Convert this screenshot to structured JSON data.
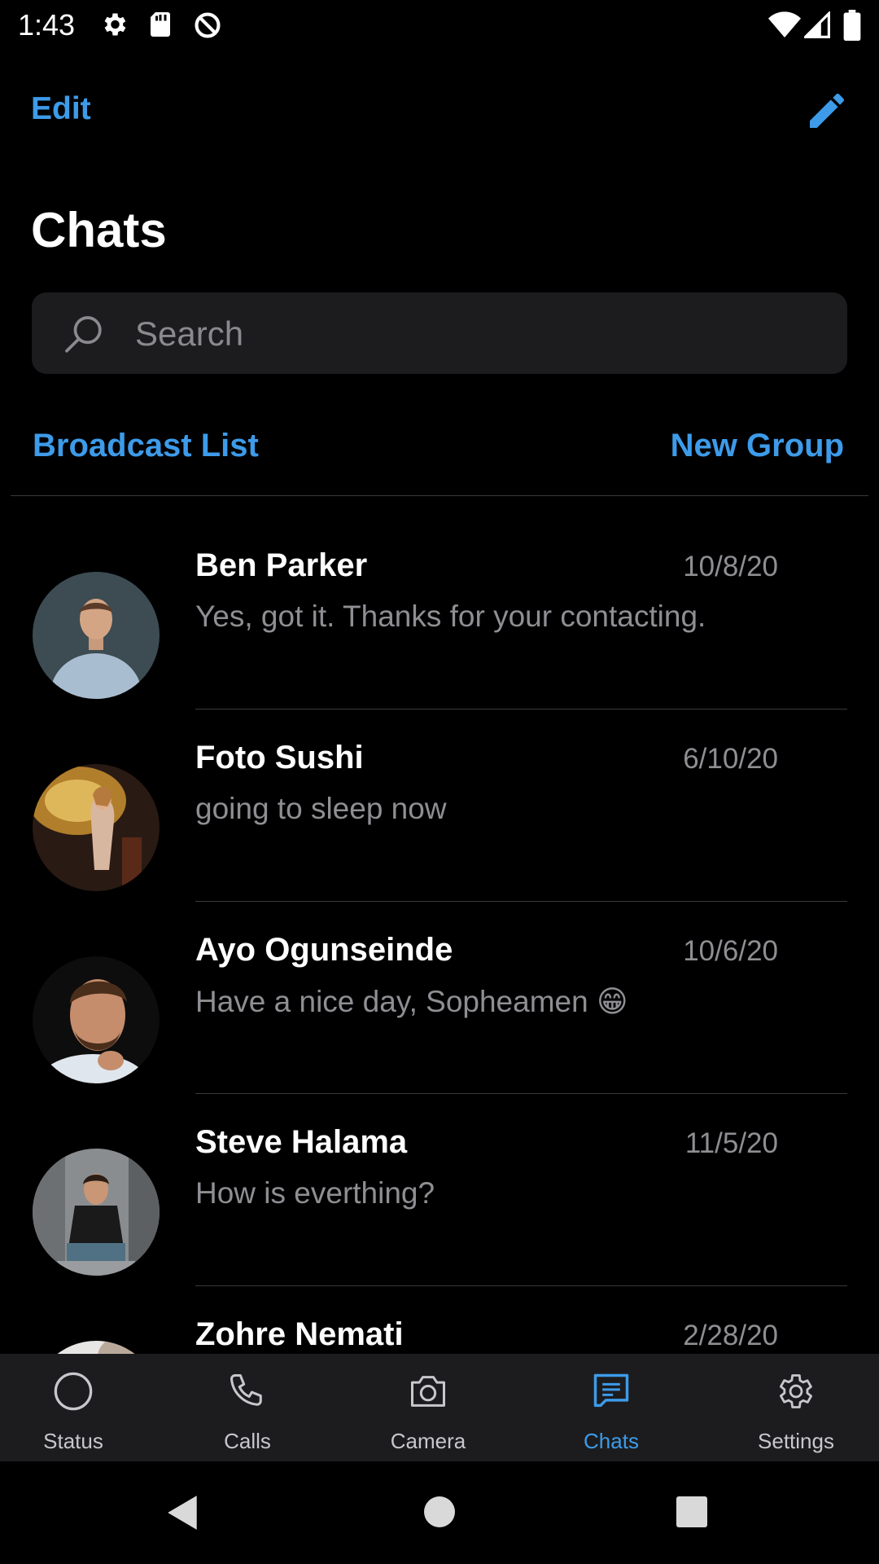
{
  "status_bar": {
    "time": "1:43",
    "icons": [
      "settings-icon",
      "sd-card-icon",
      "data-saver-icon",
      "wifi-icon",
      "cell-signal-icon",
      "battery-icon"
    ]
  },
  "header": {
    "edit_label": "Edit",
    "compose_icon": "pencil-icon",
    "title": "Chats"
  },
  "search": {
    "placeholder": "Search",
    "icon": "search-icon"
  },
  "links": {
    "broadcast": "Broadcast List",
    "new_group": "New Group"
  },
  "chats": [
    {
      "name": "Ben Parker",
      "date": "10/8/20",
      "message": "Yes, got it. Thanks for your contacting."
    },
    {
      "name": "Foto Sushi",
      "date": "6/10/20",
      "message": "going to sleep now"
    },
    {
      "name": "Ayo Ogunseinde",
      "date": "10/6/20",
      "message": "Have a nice day, Sopheamen 😁"
    },
    {
      "name": "Steve Halama",
      "date": "11/5/20",
      "message": "How is everthing?"
    },
    {
      "name": "Zohre Nemati",
      "date": "2/28/20",
      "message": ""
    }
  ],
  "tabs": [
    {
      "label": "Status",
      "icon": "status-circle-icon"
    },
    {
      "label": "Calls",
      "icon": "phone-icon"
    },
    {
      "label": "Camera",
      "icon": "camera-icon"
    },
    {
      "label": "Chats",
      "icon": "chat-bubble-icon",
      "active": true
    },
    {
      "label": "Settings",
      "icon": "gear-icon"
    }
  ],
  "colors": {
    "accent": "#3d9be9",
    "background": "#000000",
    "surface": "#1c1c1e",
    "secondary_text": "#8e8e93"
  }
}
